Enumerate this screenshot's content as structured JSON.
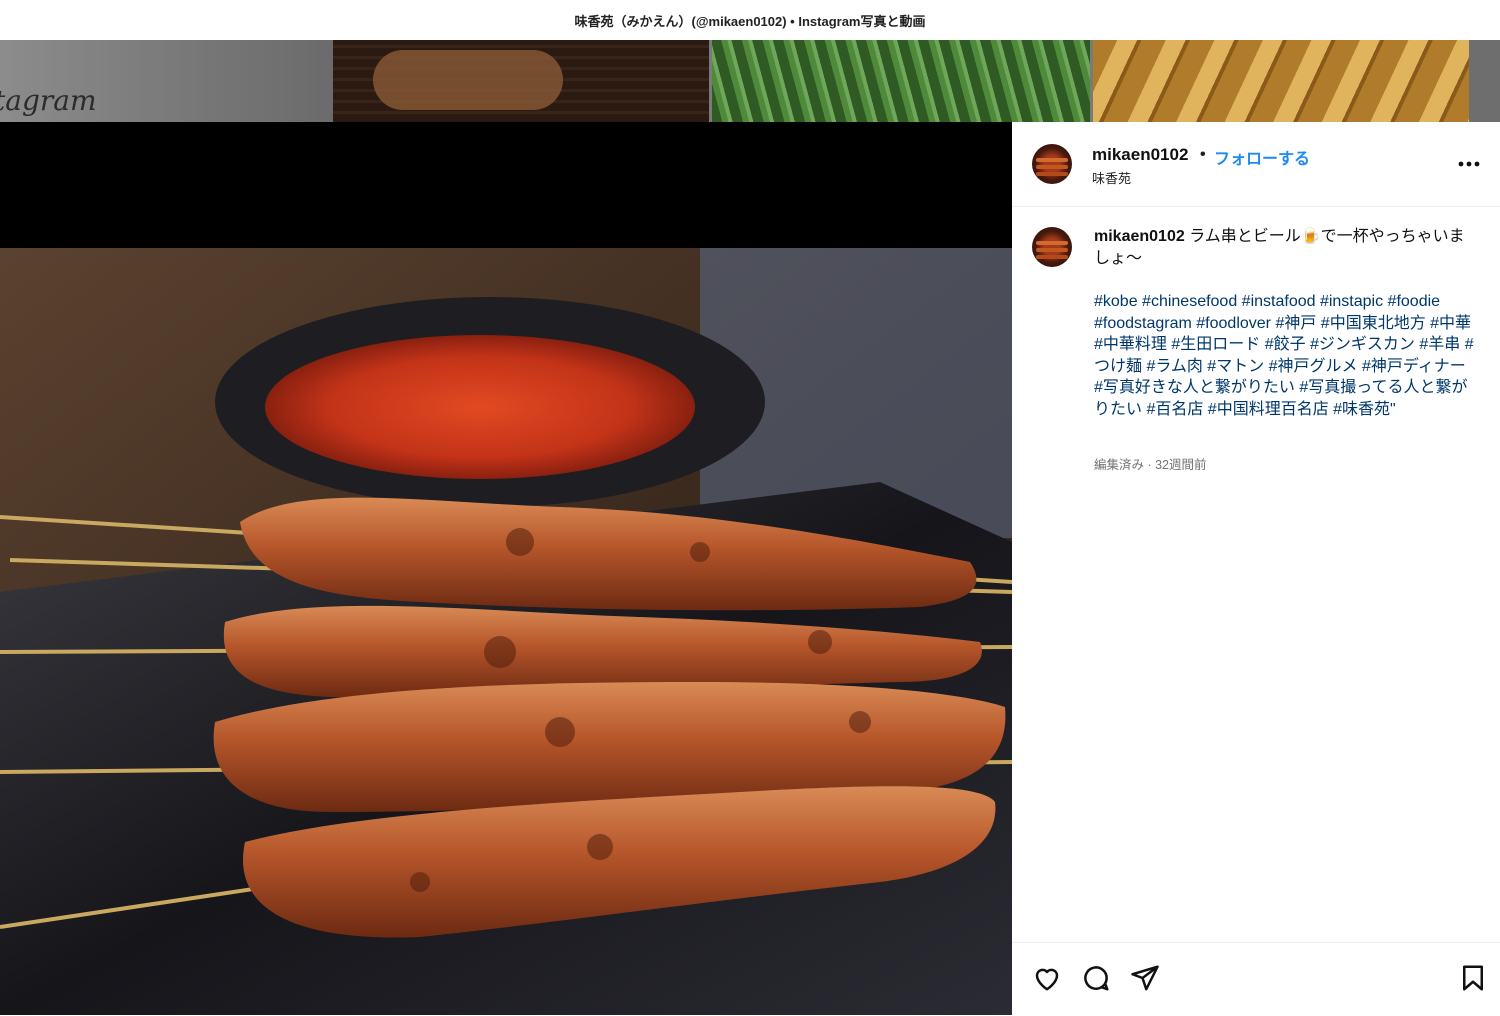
{
  "window": {
    "title": "味香苑（みかえん）(@mikaen0102) • Instagram写真と動画"
  },
  "background": {
    "logo_fragment": "tagram"
  },
  "post": {
    "username": "mikaen0102",
    "follow_label": "フォローする",
    "dot": "•",
    "location": "味香苑",
    "more_icon": "more-horizontal-icon",
    "caption_user": "mikaen0102",
    "caption_text": "ラム串とビール🍺で一杯やっちゃいましょ〜",
    "hashtags": "#kobe #chinesefood #instafood #instapic #foodie #foodstagram #foodlover #神戸 #中国東北地方 #中華 #中華料理 #生田ロード #餃子 #ジンギスカン #羊串 #つけ麺 #ラム肉 #マトン #神戸グルメ #神戸ディナー #写真好きな人と繋がりたい #写真撮ってる人と繋がりたい #百名店 #中国料理百名店 #味香苑\"",
    "meta": "編集済み · 32週間前"
  },
  "actions": {
    "like_icon": "heart-icon",
    "comment_icon": "comment-icon",
    "share_icon": "send-icon",
    "save_icon": "bookmark-icon"
  },
  "colors": {
    "link": "#1d8bf0",
    "hashtag": "#00376b",
    "muted": "#737373"
  }
}
